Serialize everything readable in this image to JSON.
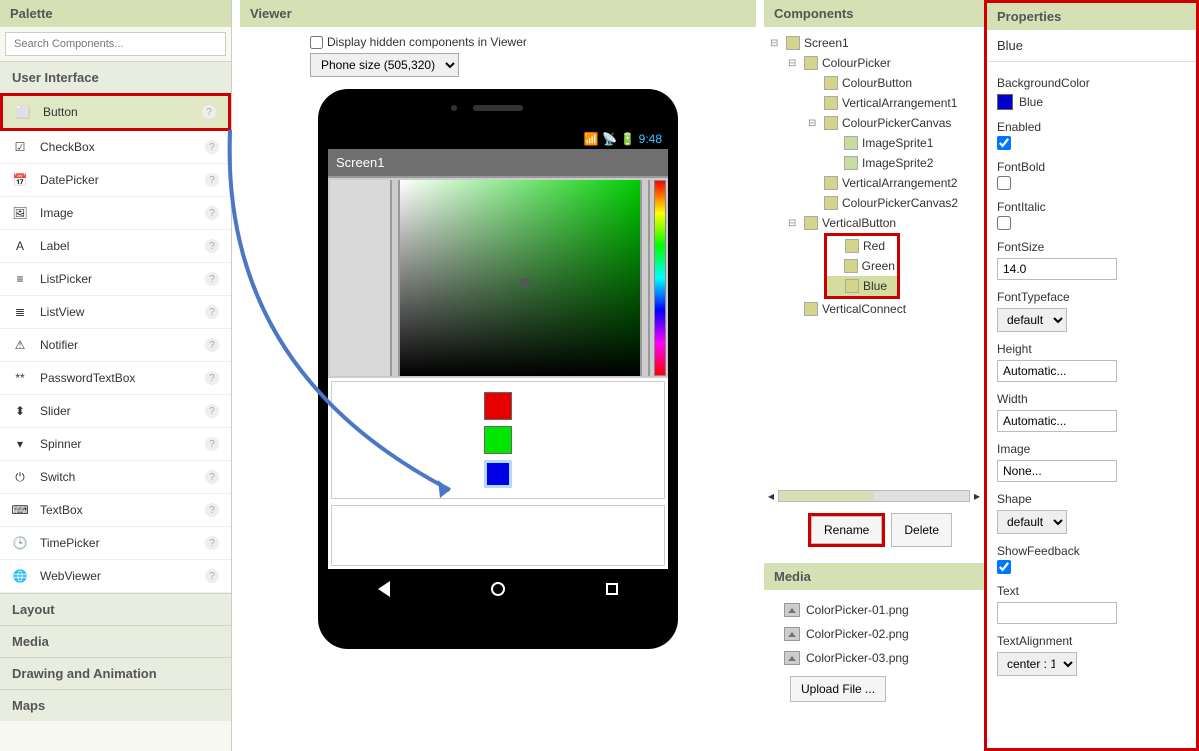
{
  "palette": {
    "title": "Palette",
    "search_placeholder": "Search Components...",
    "categories": [
      "User Interface",
      "Layout",
      "Media",
      "Drawing and Animation",
      "Maps"
    ],
    "ui_items": [
      {
        "label": "Button",
        "selected": true
      },
      {
        "label": "CheckBox"
      },
      {
        "label": "DatePicker"
      },
      {
        "label": "Image"
      },
      {
        "label": "Label"
      },
      {
        "label": "ListPicker"
      },
      {
        "label": "ListView"
      },
      {
        "label": "Notifier"
      },
      {
        "label": "PasswordTextBox"
      },
      {
        "label": "Slider"
      },
      {
        "label": "Spinner"
      },
      {
        "label": "Switch"
      },
      {
        "label": "TextBox"
      },
      {
        "label": "TimePicker"
      },
      {
        "label": "WebViewer"
      }
    ]
  },
  "viewer": {
    "title": "Viewer",
    "hidden_label": "Display hidden components in Viewer",
    "size_label": "Phone size (505,320)",
    "screen_title": "Screen1",
    "clock": "9:48"
  },
  "components": {
    "title": "Components",
    "tree": [
      {
        "label": "Screen1",
        "indent": 0,
        "exp": true
      },
      {
        "label": "ColourPicker",
        "indent": 1,
        "exp": true
      },
      {
        "label": "ColourButton",
        "indent": 2
      },
      {
        "label": "VerticalArrangement1",
        "indent": 2
      },
      {
        "label": "ColourPickerCanvas",
        "indent": 2,
        "exp": true
      },
      {
        "label": "ImageSprite1",
        "indent": 3,
        "img": true
      },
      {
        "label": "ImageSprite2",
        "indent": 3,
        "img": true
      },
      {
        "label": "VerticalArrangement2",
        "indent": 2
      },
      {
        "label": "ColourPickerCanvas2",
        "indent": 2
      },
      {
        "label": "VerticalButton",
        "indent": 1,
        "exp": true
      },
      {
        "label": "Red",
        "indent": 2,
        "group": true
      },
      {
        "label": "Green",
        "indent": 2,
        "group": true
      },
      {
        "label": "Blue",
        "indent": 2,
        "group": true,
        "sel": true
      },
      {
        "label": "VerticalConnect",
        "indent": 1
      }
    ],
    "rename": "Rename",
    "delete": "Delete"
  },
  "media": {
    "title": "Media",
    "files": [
      "ColorPicker-01.png",
      "ColorPicker-02.png",
      "ColorPicker-03.png"
    ],
    "upload": "Upload File ..."
  },
  "properties": {
    "title": "Properties",
    "selected": "Blue",
    "backgroundcolor_label": "BackgroundColor",
    "backgroundcolor_value": "Blue",
    "enabled_label": "Enabled",
    "enabled_value": true,
    "fontbold_label": "FontBold",
    "fontbold_value": false,
    "fontitalic_label": "FontItalic",
    "fontitalic_value": false,
    "fontsize_label": "FontSize",
    "fontsize_value": "14.0",
    "fonttypeface_label": "FontTypeface",
    "fonttypeface_value": "default",
    "height_label": "Height",
    "height_value": "Automatic...",
    "width_label": "Width",
    "width_value": "Automatic...",
    "image_label": "Image",
    "image_value": "None...",
    "shape_label": "Shape",
    "shape_value": "default",
    "showfeedback_label": "ShowFeedback",
    "showfeedback_value": true,
    "text_label": "Text",
    "text_value": "",
    "textalignment_label": "TextAlignment",
    "textalignment_value": "center : 1"
  }
}
